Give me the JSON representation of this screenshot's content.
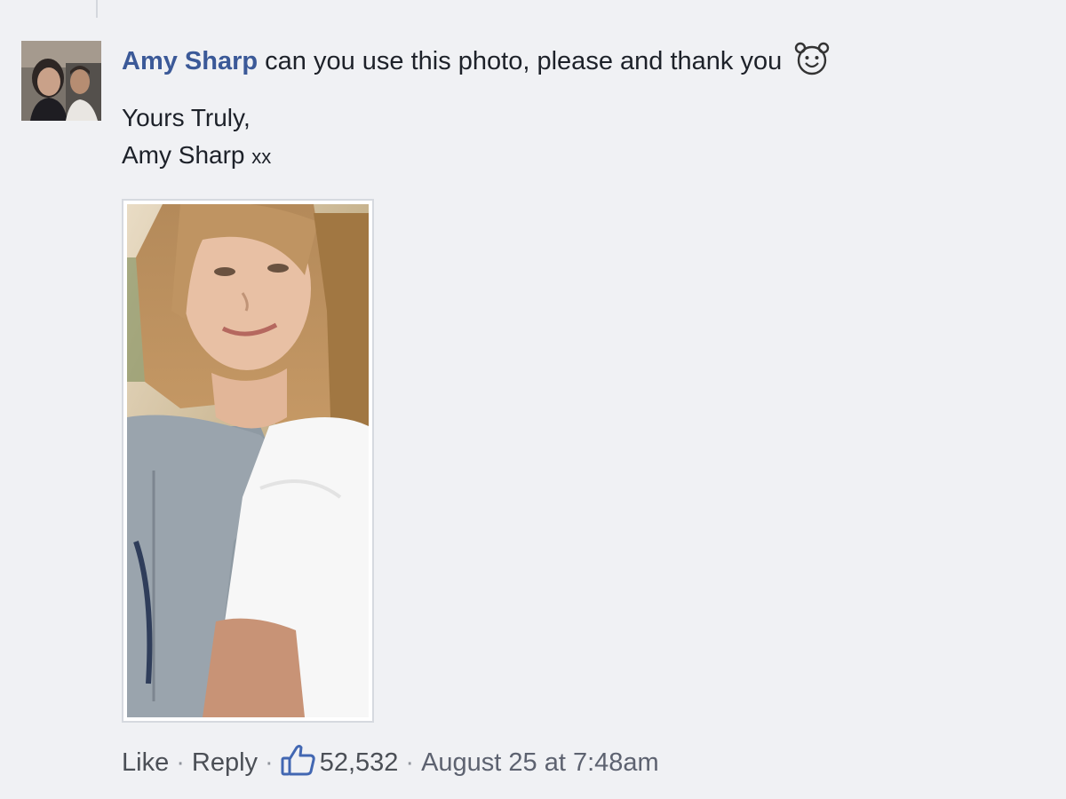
{
  "comment": {
    "author": "Amy Sharp",
    "text": "can you use this photo, please and thank you",
    "emoji": "smiling-face-emoji",
    "signoff_line1": "Yours Truly,",
    "signoff_name": "Amy Sharp",
    "signoff_suffix": "xx",
    "photo": "attached-selfie-photo"
  },
  "actions": {
    "like": "Like",
    "reply": "Reply",
    "separator": "·",
    "like_icon": "thumbs-up-icon",
    "like_count": "52,532",
    "timestamp": "August 25 at 7:48am"
  },
  "colors": {
    "author": "#3b5998",
    "background": "#f0f1f4",
    "like_icon": "#4267b2",
    "meta_text": "#4b4f56"
  }
}
